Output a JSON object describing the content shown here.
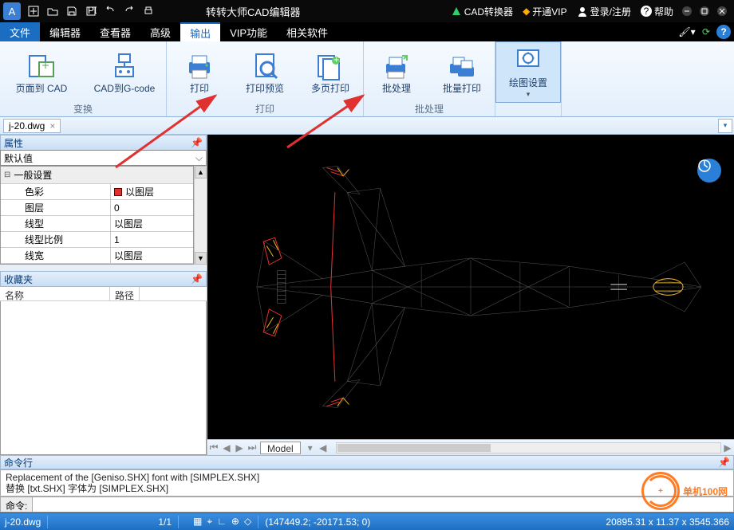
{
  "title": "转转大师CAD编辑器",
  "titlebar": {
    "converter": "CAD转换器",
    "vip": "开通VIP",
    "login": "登录/注册",
    "help": "帮助"
  },
  "menu": {
    "file": "文件",
    "tabs": [
      "编辑器",
      "查看器",
      "高级",
      "输出",
      "VIP功能",
      "相关软件"
    ],
    "active_index": 3
  },
  "ribbon": {
    "groups": [
      {
        "label": "变换",
        "items": [
          {
            "label": "页面到 CAD",
            "icon": "page-to-cad"
          },
          {
            "label": "CAD到G-code",
            "icon": "cad-to-gcode"
          }
        ]
      },
      {
        "label": "打印",
        "items": [
          {
            "label": "打印",
            "icon": "print"
          },
          {
            "label": "打印预览",
            "icon": "print-preview"
          },
          {
            "label": "多页打印",
            "icon": "multi-print"
          }
        ]
      },
      {
        "label": "批处理",
        "items": [
          {
            "label": "批处理",
            "icon": "batch"
          },
          {
            "label": "批量打印",
            "icon": "batch-print"
          }
        ]
      },
      {
        "label": "",
        "items": [
          {
            "label": "绘图设置",
            "icon": "draw-settings",
            "selected": true,
            "dropdown": true
          }
        ]
      }
    ]
  },
  "doc_tab": {
    "name": "j-20.dwg"
  },
  "properties": {
    "title": "属性",
    "default": "默认值",
    "category": "一般设置",
    "rows": [
      {
        "key": "色彩",
        "val": "以图层",
        "swatch": true
      },
      {
        "key": "图层",
        "val": "0"
      },
      {
        "key": "线型",
        "val": "以图层"
      },
      {
        "key": "线型比例",
        "val": "1"
      },
      {
        "key": "线宽",
        "val": "以图层"
      }
    ]
  },
  "favorites": {
    "title": "收藏夹",
    "col1": "名称",
    "col2": "路径"
  },
  "canvas": {
    "model_tab": "Model"
  },
  "command": {
    "title": "命令行",
    "log1": "Replacement of the [Geniso.SHX] font with [SIMPLEX.SHX]",
    "log2": "替换 [txt.SHX] 字体为 [SIMPLEX.SHX]",
    "prompt": "命令:"
  },
  "status": {
    "file": "j-20.dwg",
    "pages": "1/1",
    "coords": "(147449.2; -20171.53; 0)",
    "right": "20895.31 x 11.37 x 3545.366"
  },
  "watermark": "单机100网"
}
